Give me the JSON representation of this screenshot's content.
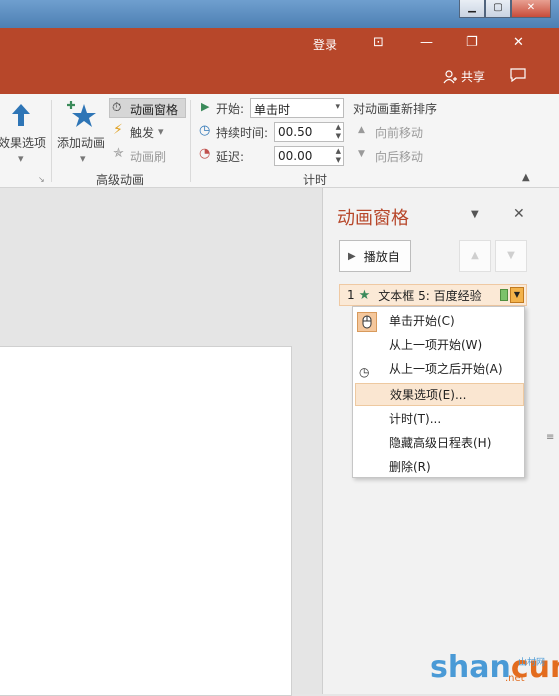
{
  "title_bar": {
    "login": "登录"
  },
  "tabs": {
    "share": "共享"
  },
  "ribbon": {
    "effect_options": "效果选项",
    "add_animation": "添加动画",
    "animation_pane": "动画窗格",
    "trigger": "触发",
    "animation_painter": "动画刷",
    "advanced_group": "高级动画",
    "start_label": "开始:",
    "start_value": "单击时",
    "duration_label": "持续时间:",
    "duration_value": "00.50",
    "delay_label": "延迟:",
    "delay_value": "00.00",
    "timing_group": "计时",
    "reorder_title": "对动画重新排序",
    "move_earlier": "向前移动",
    "move_later": "向后移动"
  },
  "pane": {
    "title": "动画窗格",
    "play_from": "播放自",
    "item": {
      "number": "1",
      "label": "文本框 5: 百度经验"
    }
  },
  "context_menu": {
    "items": [
      {
        "label": "单击开始(C)"
      },
      {
        "label": "从上一项开始(W)"
      },
      {
        "label": "从上一项之后开始(A)"
      },
      {
        "label": "效果选项(E)..."
      },
      {
        "label": "计时(T)..."
      },
      {
        "label": "隐藏高级日程表(H)"
      },
      {
        "label": "删除(R)"
      }
    ]
  },
  "watermark": {
    "brand_a": "shan",
    "brand_b": "cun",
    "net": ".net",
    "cn": "山村网"
  },
  "colors": {
    "accent": "#b7472a",
    "highlight": "#fae6d1",
    "star_green": "#3b8a5a"
  }
}
